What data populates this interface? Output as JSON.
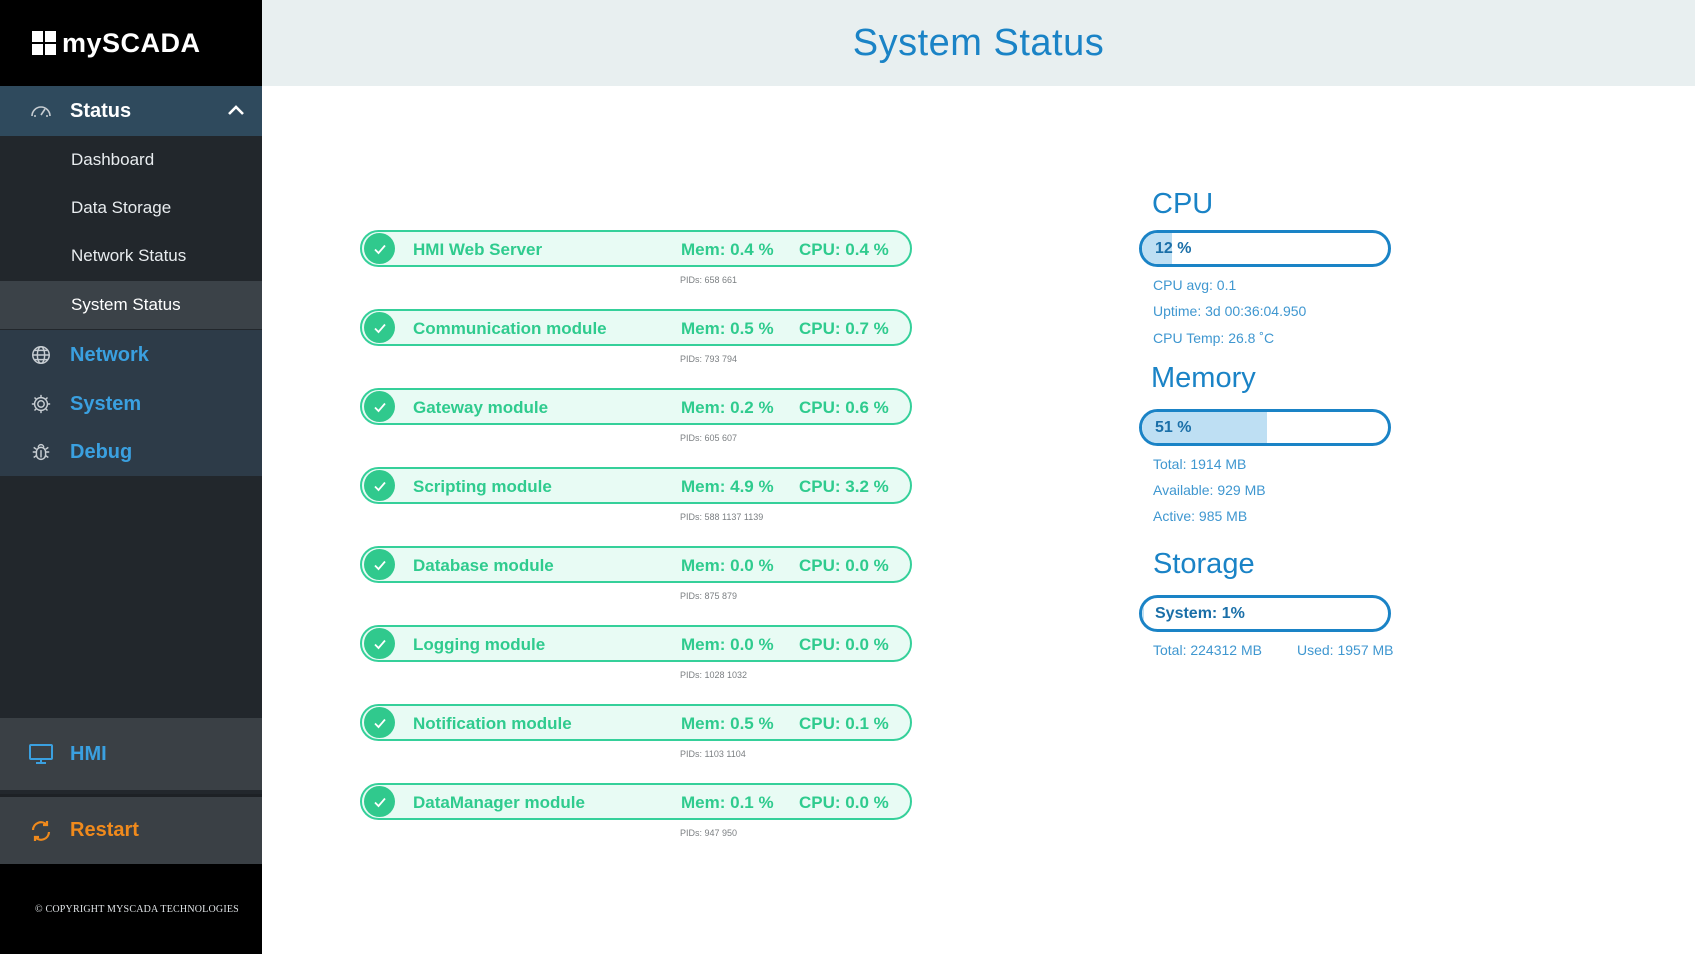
{
  "app": {
    "logo_text": "mySCADA"
  },
  "header": {
    "title": "System Status"
  },
  "sidebar": {
    "status_label": "Status",
    "sub_items": [
      "Dashboard",
      "Data Storage",
      "Network Status",
      "System Status"
    ],
    "network_label": "Network",
    "system_label": "System",
    "debug_label": "Debug",
    "hmi_label": "HMI",
    "restart_label": "Restart",
    "copyright": "© COPYRIGHT MYSCADA TECHNOLOGIES"
  },
  "services": [
    {
      "name": "HMI Web Server",
      "mem": "Mem: 0.4 %",
      "cpu": "CPU: 0.4 %",
      "pids": "PIDs: 658 661"
    },
    {
      "name": "Communication module",
      "mem": "Mem: 0.5 %",
      "cpu": "CPU: 0.7 %",
      "pids": "PIDs: 793 794"
    },
    {
      "name": "Gateway module",
      "mem": "Mem: 0.2 %",
      "cpu": "CPU: 0.6 %",
      "pids": "PIDs: 605 607"
    },
    {
      "name": "Scripting module",
      "mem": "Mem: 4.9 %",
      "cpu": "CPU: 3.2 %",
      "pids": "PIDs: 588 1137 1139"
    },
    {
      "name": "Database module",
      "mem": "Mem: 0.0 %",
      "cpu": "CPU: 0.0 %",
      "pids": "PIDs: 875 879"
    },
    {
      "name": "Logging module",
      "mem": "Mem: 0.0 %",
      "cpu": "CPU: 0.0 %",
      "pids": "PIDs: 1028 1032"
    },
    {
      "name": "Notification module",
      "mem": "Mem: 0.5 %",
      "cpu": "CPU: 0.1 %",
      "pids": "PIDs: 1103 1104"
    },
    {
      "name": "DataManager module",
      "mem": "Mem: 0.1 %",
      "cpu": "CPU: 0.0 %",
      "pids": "PIDs: 947 950"
    }
  ],
  "cpu": {
    "title": "CPU",
    "bar_label": "12 %",
    "percent": 12,
    "avg": "CPU avg: 0.1",
    "uptime": "Uptime: 3d 00:36:04.950",
    "temp": "CPU Temp: 26.8 ˚C"
  },
  "memory": {
    "title": "Memory",
    "bar_label": "51 %",
    "percent": 51,
    "total": "Total: 1914 MB",
    "available": "Available: 929 MB",
    "active": "Active: 985 MB"
  },
  "storage": {
    "title": "Storage",
    "bar_label": "System: 1%",
    "percent": 1,
    "total": "Total: 224312 MB",
    "used": "Used: 1957 MB"
  },
  "colors": {
    "accent": "#1a83c6",
    "ok": "#2fcb8e",
    "restart": "#f08a1c",
    "sidebar_bg": "#22272c"
  }
}
